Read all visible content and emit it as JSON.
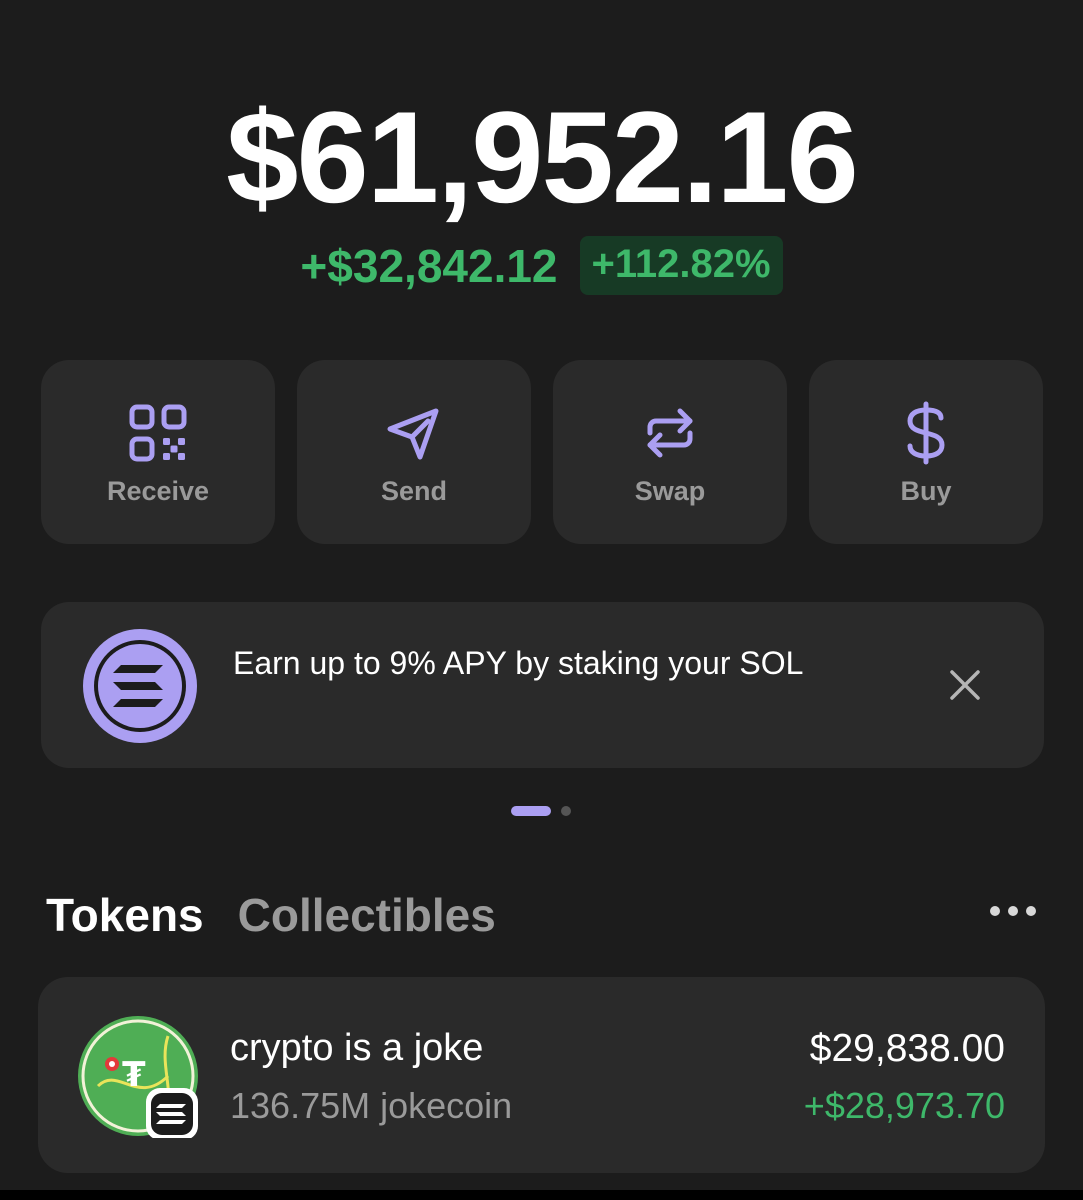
{
  "balance": {
    "total": "$61,952.16",
    "change_amount": "+$32,842.12",
    "change_percent": "+112.82%"
  },
  "actions": [
    {
      "label": "Receive",
      "icon": "qr-code-icon"
    },
    {
      "label": "Send",
      "icon": "send-icon"
    },
    {
      "label": "Swap",
      "icon": "swap-icon"
    },
    {
      "label": "Buy",
      "icon": "dollar-icon"
    }
  ],
  "promo": {
    "text": "Earn up to 9% APY by staking your SOL",
    "icon": "solana-logo-icon"
  },
  "tabs": {
    "active": "Tokens",
    "inactive": "Collectibles"
  },
  "tokens": [
    {
      "name": "crypto is a joke",
      "amount": "136.75M jokecoin",
      "value": "$29,838.00",
      "change": "+$28,973.70"
    }
  ],
  "colors": {
    "background": "#1c1c1c",
    "card": "#2a2a2a",
    "accent": "#ab9ff2",
    "positive": "#3eb86a",
    "muted": "#9a9a9a"
  }
}
